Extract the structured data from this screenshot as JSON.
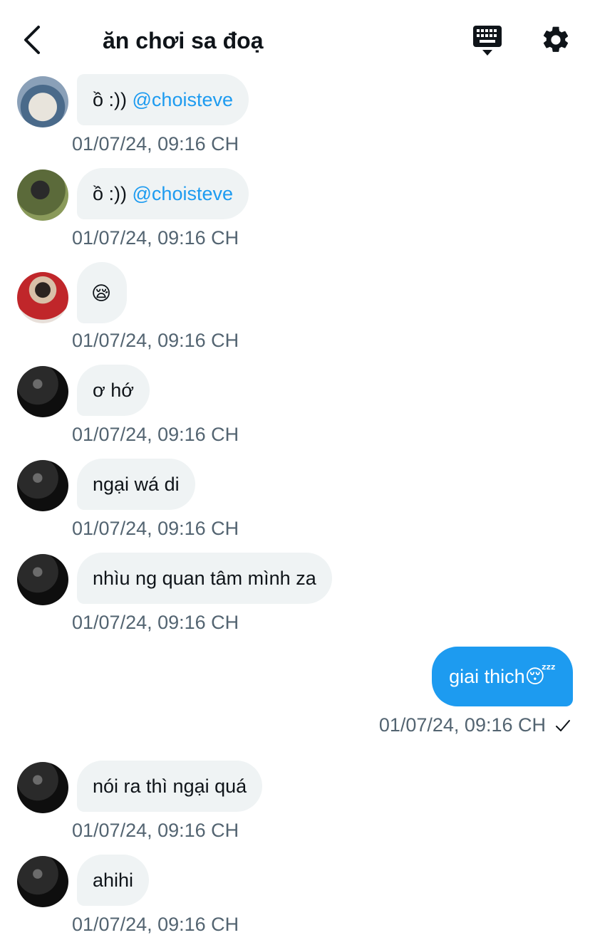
{
  "header": {
    "title": "ăn chơi sa đoạ"
  },
  "messages": [
    {
      "text": "ồ :)) ",
      "mention": "@choisteve",
      "time": "01/07/24, 09:16 CH"
    },
    {
      "text": "ồ :)) ",
      "mention": "@choisteve",
      "time": "01/07/24, 09:16 CH"
    },
    {
      "text": "😪",
      "time": "01/07/24, 09:16 CH"
    },
    {
      "text": "ơ hớ",
      "time": "01/07/24, 09:16 CH"
    },
    {
      "text": "ngại wá di",
      "time": "01/07/24, 09:16 CH"
    },
    {
      "text": "nhìu ng quan tâm mình za",
      "time": "01/07/24, 09:16 CH"
    },
    {
      "text": "giai thich😴",
      "time": "01/07/24, 09:16 CH"
    },
    {
      "text": "nói ra thì ngại quá",
      "time": "01/07/24, 09:16 CH"
    },
    {
      "text": "ahihi",
      "time": "01/07/24, 09:16 CH"
    }
  ],
  "colors": {
    "accent": "#1d9bf0",
    "bubble_other": "#eff3f4",
    "timestamp": "#536471"
  }
}
